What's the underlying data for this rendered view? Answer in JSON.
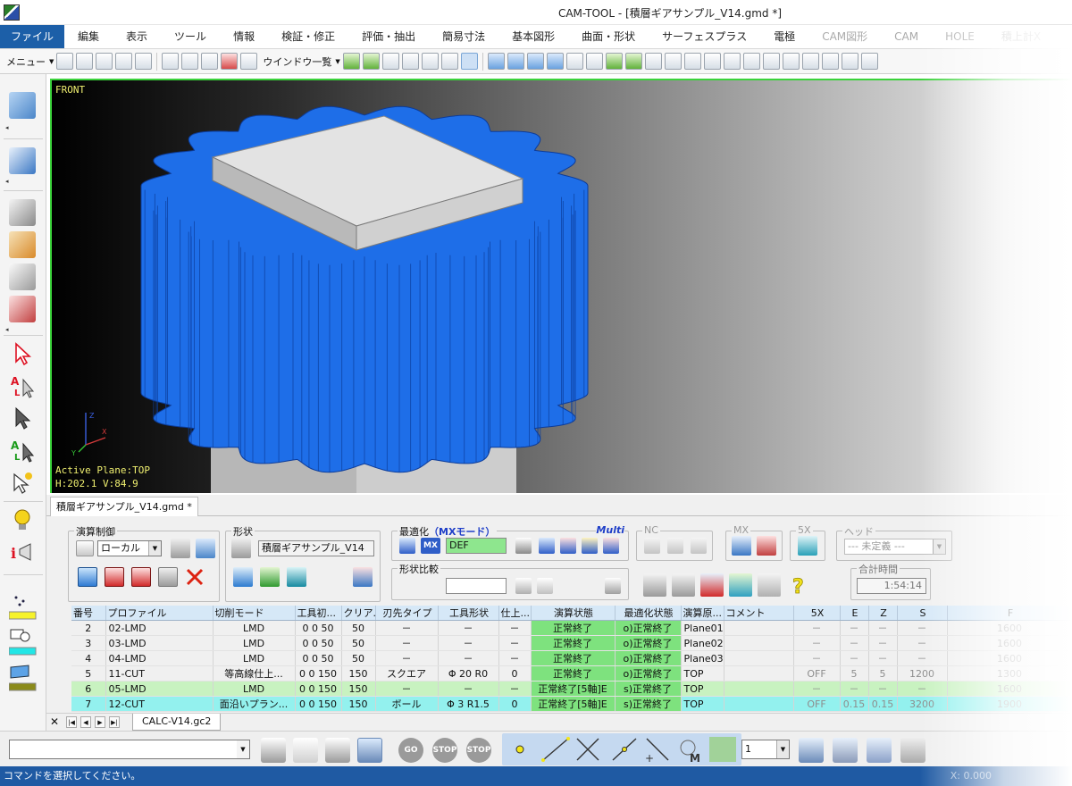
{
  "window": {
    "title": "CAM-TOOL - [積層ギアサンプル_V14.gmd *]"
  },
  "menu": {
    "items": [
      "ファイル",
      "編集",
      "表示",
      "ツール",
      "情報",
      "検証・修正",
      "評価・抽出",
      "簡易寸法",
      "基本図形",
      "曲面・形状",
      "サーフェスプラス",
      "電極",
      "CAM図形",
      "CAM",
      "HOLE",
      "積上計X"
    ]
  },
  "toolbar": {
    "menu_label": "メニュー",
    "window_list_label": "ウインドウ一覧"
  },
  "viewport": {
    "view_label": "FRONT",
    "active_plane": "Active Plane:TOP",
    "coords": "H:202.1 V:84.9",
    "colors": {
      "gear": "#1e6ee8",
      "block": "#c6c6c6",
      "frame": "#3bd23b"
    }
  },
  "document_tab": {
    "label": "積層ギアサンプル_V14.gmd *"
  },
  "panel": {
    "calc_control": {
      "title": "演算制御",
      "location_value": "ローカル"
    },
    "shape": {
      "title": "形状",
      "name_value": "積層ギアサンプル_V14"
    },
    "optimize": {
      "title": "最適化",
      "mode": "（MXモード）",
      "multi": "Multi",
      "def_value": "DEF"
    },
    "shape_compare": {
      "title": "形状比較",
      "value": ""
    },
    "nc": {
      "title": "NC"
    },
    "mx": {
      "title": "MX"
    },
    "fivex": {
      "title": "5X"
    },
    "head": {
      "title": "ヘッド",
      "value": "--- 未定義 ---"
    },
    "total_time": {
      "title": "合計時間",
      "value": "1:54:14"
    }
  },
  "table": {
    "headers": [
      "番号",
      "プロファイル",
      "切削モード",
      "工具初...",
      "クリア...",
      "刃先タイプ",
      "工具形状",
      "仕上...",
      "演算状態",
      "最適化状態",
      "演算原...",
      "コメント",
      "5X",
      "E",
      "Z",
      "S",
      "F"
    ],
    "rows": [
      [
        "2",
        "02-LMD",
        "LMD",
        "0 0 50",
        "50",
        "－",
        "－",
        "－",
        "正常終了",
        "o)正常終了",
        "Plane01",
        "",
        "－",
        "－",
        "－",
        "－",
        "1600"
      ],
      [
        "3",
        "03-LMD",
        "LMD",
        "0 0 50",
        "50",
        "－",
        "－",
        "－",
        "正常終了",
        "o)正常終了",
        "Plane02",
        "",
        "－",
        "－",
        "－",
        "－",
        "1600"
      ],
      [
        "4",
        "04-LMD",
        "LMD",
        "0 0 50",
        "50",
        "－",
        "－",
        "－",
        "正常終了",
        "o)正常終了",
        "Plane03",
        "",
        "－",
        "－",
        "－",
        "－",
        "1600"
      ],
      [
        "5",
        "11-CUT",
        "等高線仕上...",
        "0 0 150",
        "150",
        "スクエア",
        "Φ 20 R0",
        "0",
        "正常終了",
        "o)正常終了",
        "TOP",
        "",
        "OFF",
        "5",
        "5",
        "1200",
        "1300"
      ],
      [
        "6",
        "05-LMD",
        "LMD",
        "0 0 150",
        "150",
        "－",
        "－",
        "－",
        "正常終了[5軸]E",
        "s)正常終了",
        "TOP",
        "",
        "－",
        "－",
        "－",
        "－",
        "1600"
      ],
      [
        "7",
        "12-CUT",
        "面沿いプラン...",
        "0 0 150",
        "150",
        "ボール",
        "Φ 3 R1.5",
        "0",
        "正常終了[5軸]E",
        "s)正常終了",
        "TOP",
        "",
        "OFF",
        "0.15",
        "0.15",
        "3200",
        "1900"
      ]
    ]
  },
  "sheet_tab": {
    "label": "CALC-V14.gc2"
  },
  "cmdbar": {
    "stop1": "STOP",
    "stop2": "STOP",
    "go": "GO",
    "snap_value": "1",
    "mark_m": "M"
  },
  "status": {
    "message": "コマンドを選択してください。",
    "coords": "X: 0.000"
  }
}
